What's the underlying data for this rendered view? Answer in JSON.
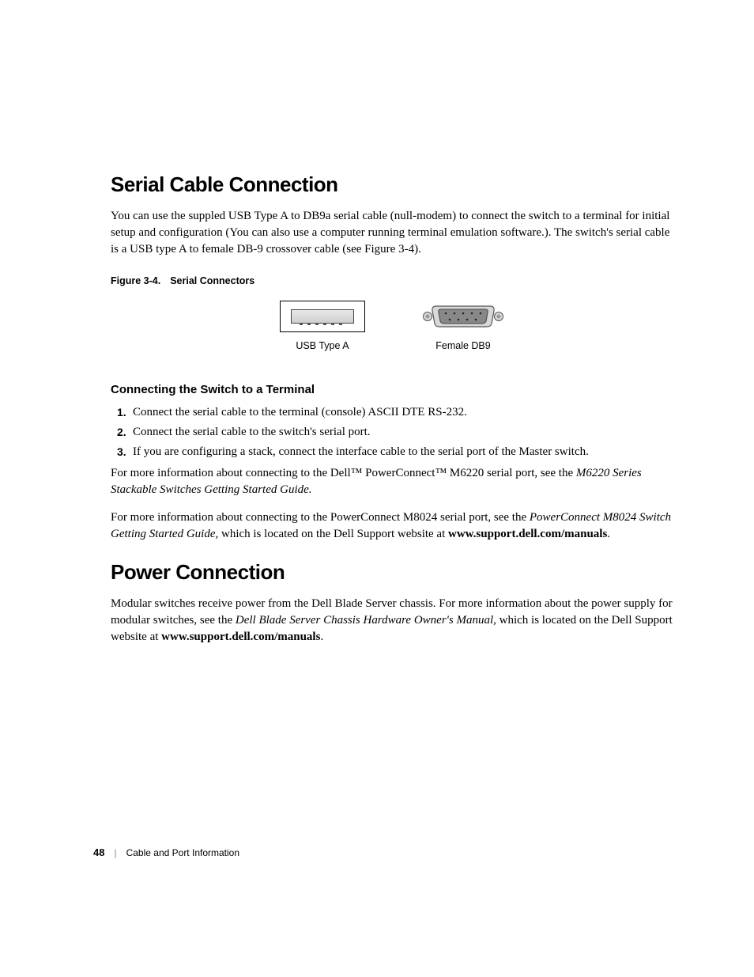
{
  "section1": {
    "heading": "Serial Cable Connection",
    "para1": "You can use the suppled USB Type A to DB9a serial cable (null-modem) to connect the switch to a terminal for initial setup and configuration (You can also use a computer running terminal emulation software.). The switch's serial cable is a USB type A to female DB-9 crossover cable (see Figure 3-4).",
    "figure": {
      "label": "Figure 3-4.",
      "title": "Serial Connectors",
      "usb_label": "USB Type A",
      "db9_label": "Female DB9"
    },
    "subheading": "Connecting the Switch to a Terminal",
    "steps": [
      "Connect the serial cable to the terminal (console) ASCII DTE RS-232.",
      "Connect the serial cable to the switch's serial port.",
      "If you are configuring a stack, connect the interface cable to the serial port of the Master switch."
    ],
    "para2_part1": "For more information about connecting to the Dell™ PowerConnect™ M6220 serial port, see the ",
    "para2_italic": "M6220 Series Stackable Switches Getting Started Guide.",
    "para3_part1": "For more information about connecting to the PowerConnect M8024 serial port, see the ",
    "para3_italic": "PowerConnect M8024 Switch Getting Started Guide,",
    "para3_part2": " which is located on the Dell Support website at ",
    "para3_bold": "www.support.dell.com/manuals",
    "para3_end": "."
  },
  "section2": {
    "heading": "Power Connection",
    "para_part1": "Modular switches receive power from the Dell Blade Server chassis. For more information about the power supply for modular switches, see the ",
    "para_italic": "Dell Blade Server Chassis Hardware Owner's Manual,",
    "para_part2": " which is located on the Dell Support website at ",
    "para_bold": "www.support.dell.com/manuals",
    "para_end": "."
  },
  "footer": {
    "page": "48",
    "divider": "|",
    "text": "Cable and Port Information"
  }
}
